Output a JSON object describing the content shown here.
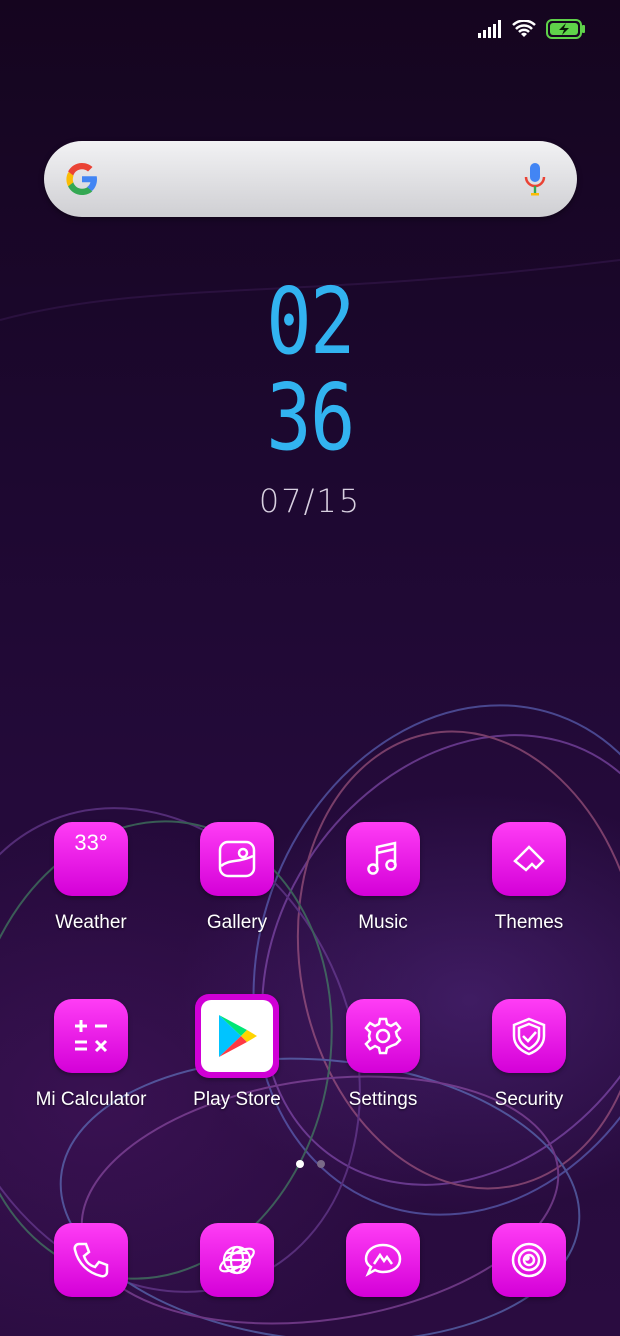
{
  "status_bar": {
    "signal_icon": "signal-bars-icon",
    "wifi_icon": "wifi-icon",
    "battery_icon": "battery-charging-icon",
    "battery_color": "#5fd24a"
  },
  "search_bar": {
    "logo_icon": "google-g-icon",
    "mic_icon": "microphone-icon"
  },
  "clock": {
    "hour": "02",
    "minute": "36",
    "date": "07/15",
    "color": "#32b3f0"
  },
  "apps_row1": [
    {
      "label": "Weather",
      "icon": "weather-icon",
      "temp": "33°"
    },
    {
      "label": "Gallery",
      "icon": "gallery-icon"
    },
    {
      "label": "Music",
      "icon": "music-note-icon"
    },
    {
      "label": "Themes",
      "icon": "paint-brush-icon"
    }
  ],
  "apps_row2": [
    {
      "label": "Mi Calculator",
      "icon": "calculator-icon"
    },
    {
      "label": "Play Store",
      "icon": "play-store-icon"
    },
    {
      "label": "Settings",
      "icon": "gear-icon"
    },
    {
      "label": "Security",
      "icon": "shield-icon"
    }
  ],
  "page_indicator": {
    "pages": 2,
    "active": 0
  },
  "dock": [
    {
      "icon": "phone-icon"
    },
    {
      "icon": "browser-globe-icon"
    },
    {
      "icon": "messages-icon"
    },
    {
      "icon": "camera-icon"
    }
  ],
  "accent_color": "#e81ee6"
}
